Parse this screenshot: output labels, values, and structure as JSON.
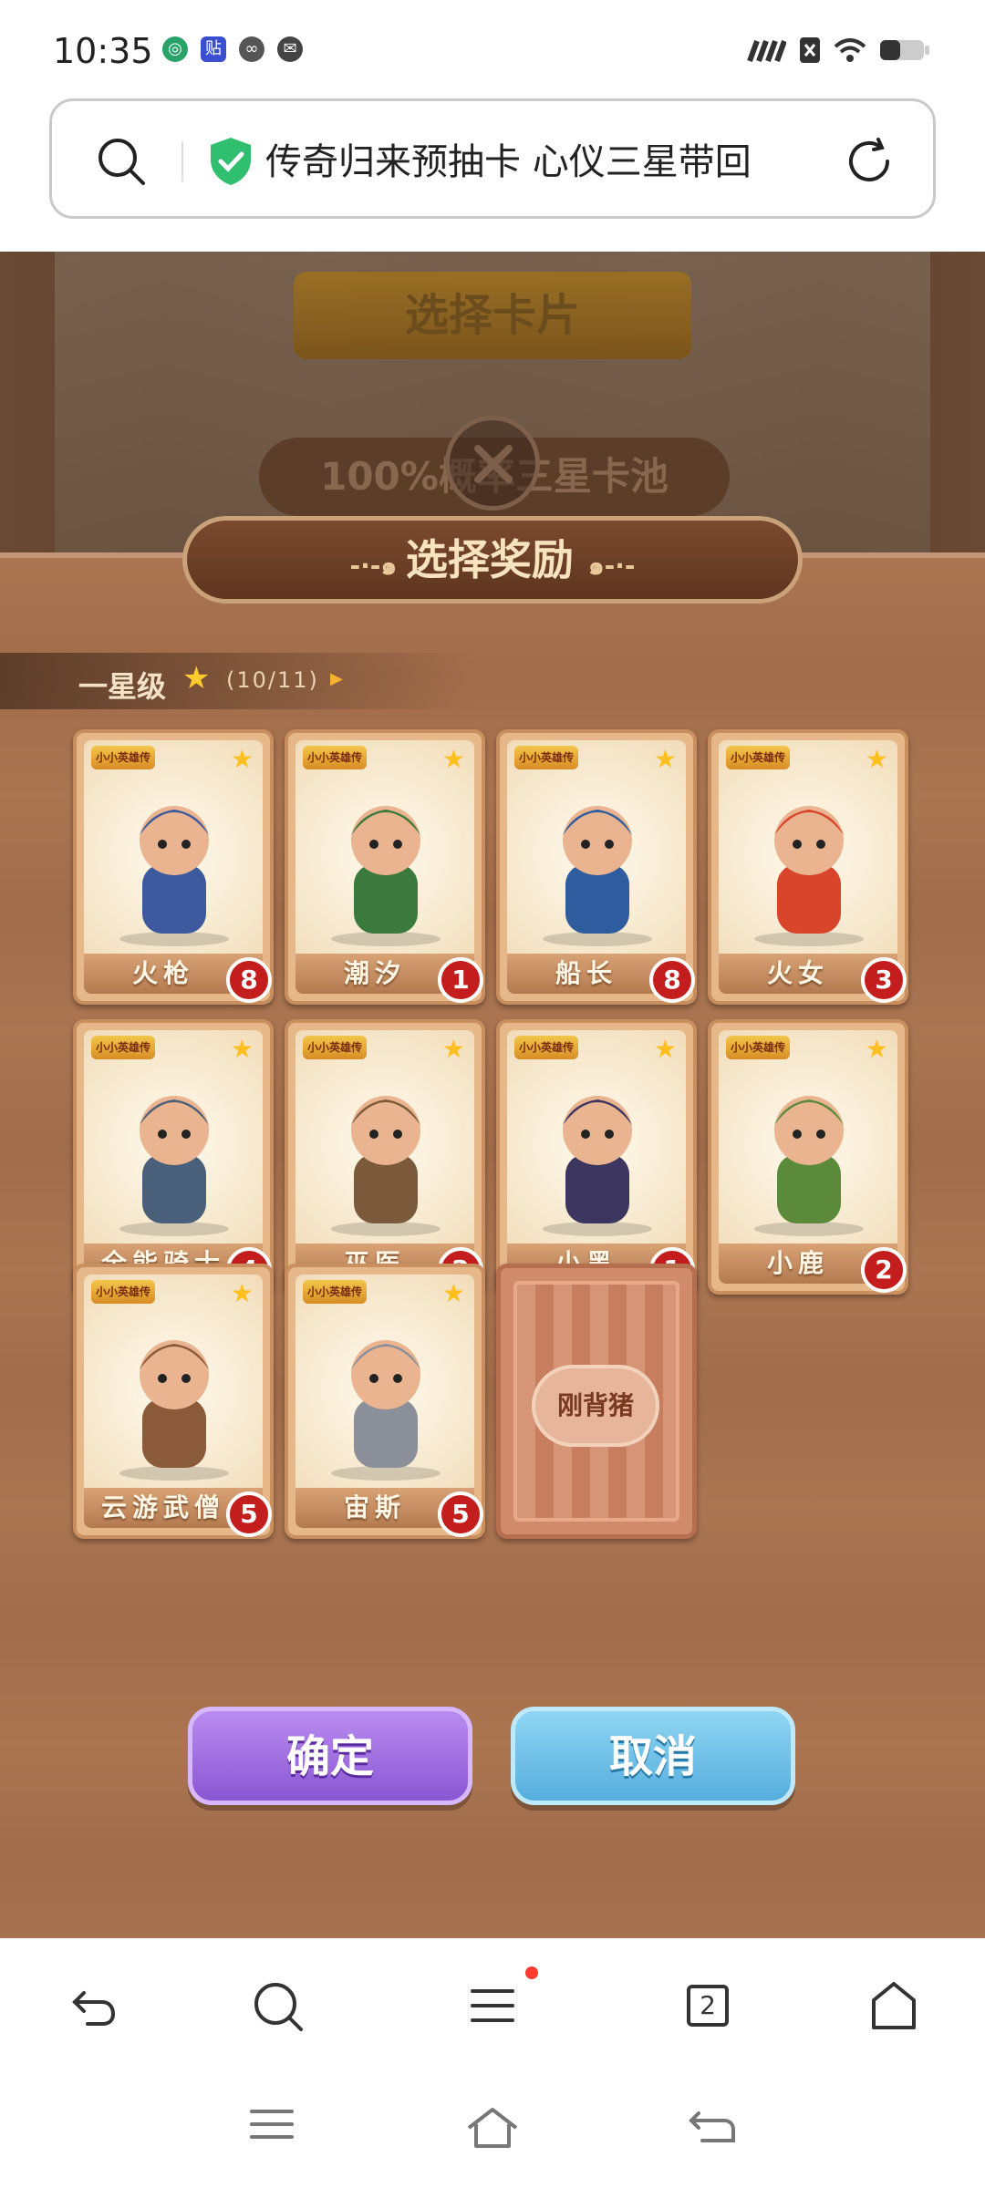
{
  "status_bar": {
    "time": "10:35",
    "icons_left": [
      "network-icon",
      "tieba-icon",
      "link-icon",
      "wechat-icon"
    ],
    "icons_right": [
      "signal-icon",
      "sim-icon",
      "wifi-icon",
      "battery-icon"
    ]
  },
  "address_bar": {
    "url_title": "传奇归来预抽卡 心仪三星带回"
  },
  "game": {
    "background_title": "选择卡片",
    "background_pool": "100%概率三星卡池",
    "panel_title": "选择奖励",
    "tier": {
      "label": "一星级",
      "count": "(10/11)"
    },
    "card_logo": "小小英雄传",
    "cards": [
      {
        "name": "火枪",
        "count": "8"
      },
      {
        "name": "潮汐",
        "count": "1"
      },
      {
        "name": "船长",
        "count": "8"
      },
      {
        "name": "火女",
        "count": "3"
      },
      {
        "name": "全能骑士",
        "count": "4"
      },
      {
        "name": "巫医",
        "count": "2"
      },
      {
        "name": "小黑",
        "count": "1"
      },
      {
        "name": "小鹿",
        "count": "2"
      },
      {
        "name": "云游武僧",
        "count": "5"
      },
      {
        "name": "宙斯",
        "count": "5"
      }
    ],
    "card_back_label": "刚背猪",
    "confirm_label": "确定",
    "cancel_label": "取消"
  },
  "toolbar": {
    "tab_count": "2"
  },
  "colors": {
    "confirm": "#9a66e0",
    "cancel": "#66bbe6",
    "badge": "#c41d1d",
    "wood": "#a8704d"
  }
}
